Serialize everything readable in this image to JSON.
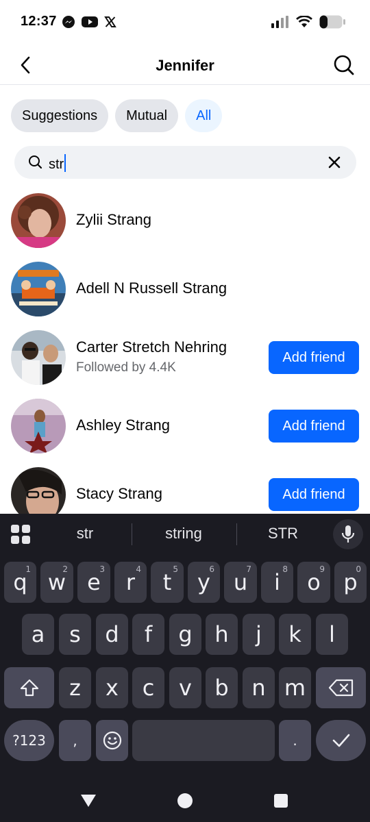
{
  "status": {
    "time": "12:37",
    "app_icons": [
      "messenger-icon",
      "youtube-icon",
      "x-icon"
    ],
    "battery_level": 0.35
  },
  "header": {
    "title": "Jennifer"
  },
  "filters": [
    {
      "label": "Suggestions",
      "active": false
    },
    {
      "label": "Mutual",
      "active": false
    },
    {
      "label": "All",
      "active": true
    }
  ],
  "search": {
    "value": "str"
  },
  "results": [
    {
      "name": "Zylii Strang",
      "subtitle": "",
      "action": ""
    },
    {
      "name": "Adell N Russell Strang",
      "subtitle": "",
      "action": ""
    },
    {
      "name": "Carter Stretch Nehring",
      "subtitle": "Followed by 4.4K",
      "action": "Add friend"
    },
    {
      "name": "Ashley Strang",
      "subtitle": "",
      "action": "Add friend"
    },
    {
      "name": "Stacy Strang",
      "subtitle": "",
      "action": "Add friend"
    }
  ],
  "keyboard": {
    "suggestions": [
      "str",
      "string",
      "STR"
    ],
    "row1": [
      {
        "key": "q",
        "hint": "1"
      },
      {
        "key": "w",
        "hint": "2"
      },
      {
        "key": "e",
        "hint": "3"
      },
      {
        "key": "r",
        "hint": "4"
      },
      {
        "key": "t",
        "hint": "5"
      },
      {
        "key": "y",
        "hint": "6"
      },
      {
        "key": "u",
        "hint": "7"
      },
      {
        "key": "i",
        "hint": "8"
      },
      {
        "key": "o",
        "hint": "9"
      },
      {
        "key": "p",
        "hint": "0"
      }
    ],
    "row2": [
      "a",
      "s",
      "d",
      "f",
      "g",
      "h",
      "j",
      "k",
      "l"
    ],
    "row3": [
      "z",
      "x",
      "c",
      "v",
      "b",
      "n",
      "m"
    ],
    "symbols_label": "?123",
    "comma": ",",
    "period": "."
  }
}
